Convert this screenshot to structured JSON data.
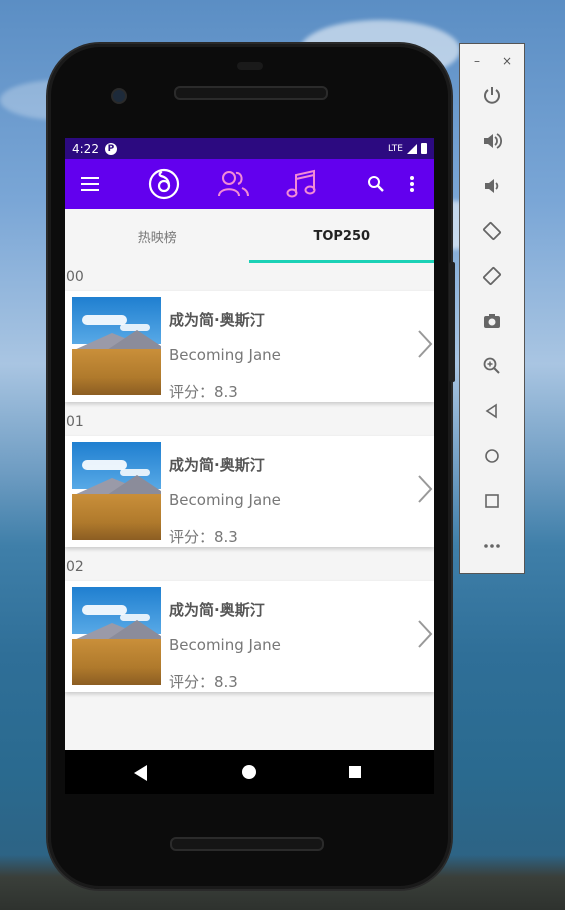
{
  "status": {
    "time": "4:22",
    "network": "LTE"
  },
  "tabs": [
    {
      "label": "热映榜"
    },
    {
      "label": "TOP250"
    }
  ],
  "movies": [
    {
      "index": "00",
      "title": "成为简·奥斯汀",
      "subtitle": "Becoming Jane",
      "score": "评分：8.3"
    },
    {
      "index": "01",
      "title": "成为简·奥斯汀",
      "subtitle": "Becoming Jane",
      "score": "评分：8.3"
    },
    {
      "index": "02",
      "title": "成为简·奥斯汀",
      "subtitle": "Becoming Jane",
      "score": "评分：8.3"
    }
  ],
  "panel": {
    "minimize": "–",
    "close": "×"
  },
  "colors": {
    "primary": "#6200ee",
    "status_bar": "#2c0a80",
    "tab_indicator": "#1bd1b6",
    "icon_tint": "#f28bd6"
  },
  "icons": [
    "menu-icon",
    "music-note-logo-icon",
    "friends-icon",
    "music-notes-icon",
    "search-icon",
    "more-vert-icon",
    "chevron-right-icon"
  ]
}
